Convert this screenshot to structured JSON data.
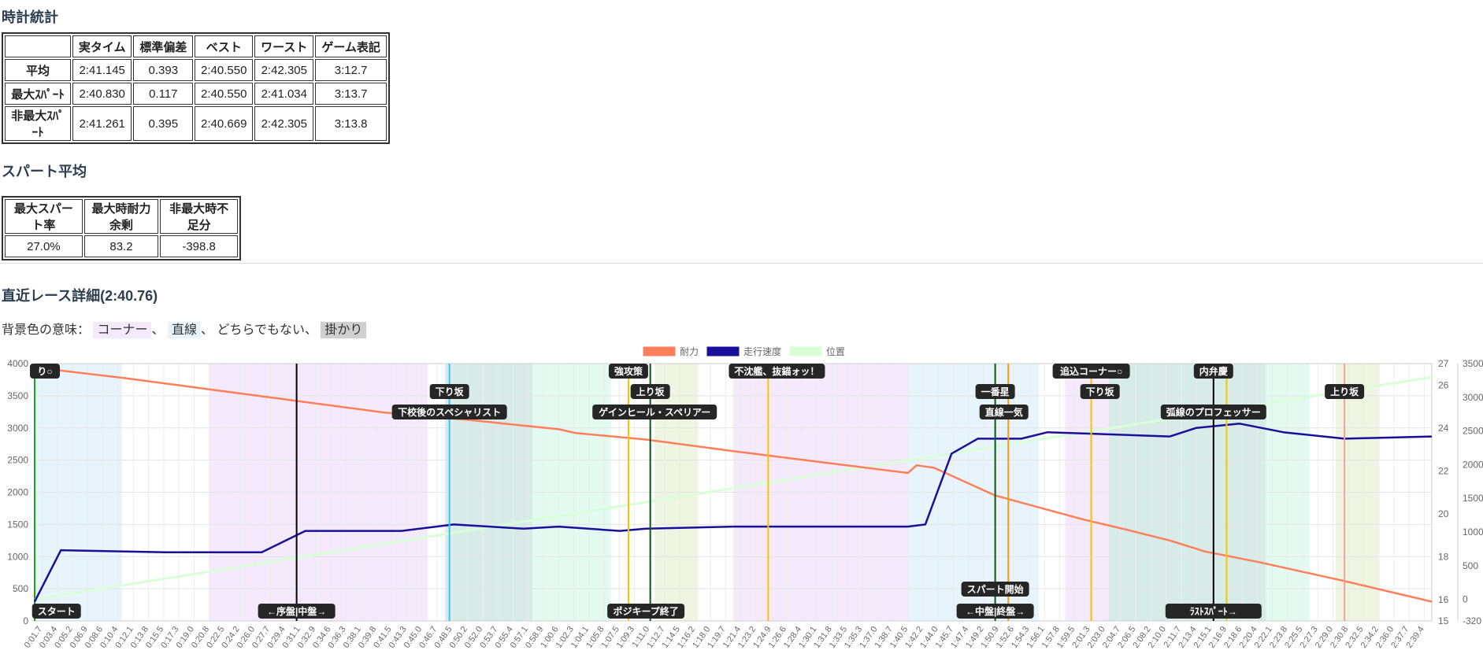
{
  "clock_stats": {
    "title": "時計統計",
    "headers": [
      "",
      "実タイム",
      "標準偏差",
      "ベスト",
      "ワースト",
      "ゲーム表記"
    ],
    "rows": [
      [
        "平均",
        "2:41.145",
        "0.393",
        "2:40.550",
        "2:42.305",
        "3:12.7"
      ],
      [
        "最大ｽﾊﾟｰﾄ",
        "2:40.830",
        "0.117",
        "2:40.550",
        "2:41.034",
        "3:13.7"
      ],
      [
        "非最大ｽﾊﾟｰﾄ",
        "2:41.261",
        "0.395",
        "2:40.669",
        "2:42.305",
        "3:13.8"
      ]
    ]
  },
  "spurt_avg": {
    "title": "スパート平均",
    "headers": [
      "最大スパート率",
      "最大時耐力余剰",
      "非最大時不足分"
    ],
    "values": [
      "27.0%",
      "83.2",
      "-398.8"
    ]
  },
  "recent_race": {
    "title": "直近レース詳細(2:40.76)",
    "bg_legend": {
      "prefix": "背景色の意味：",
      "corner": "コーナー",
      "sep1": "、",
      "straight": "直線",
      "sep2": "、",
      "neither": "どちらでもない、",
      "kakari": "掛かり"
    }
  },
  "colors": {
    "stamina": "#ff7f5a",
    "speed": "#1a0f9a",
    "position": "#d9ffd9",
    "corner_bg": "#f4eafc",
    "straight_bg": "#e8f4fb",
    "kakari_bg": "#d0d0d0"
  },
  "chart_data": {
    "type": "line",
    "legend": [
      "耐力",
      "走行速度",
      "位置"
    ],
    "y_left": {
      "min": 0,
      "max": 4000,
      "ticks": [
        "4000",
        "3500",
        "3000",
        "2500",
        "2000",
        "1500",
        "1000",
        "500",
        "0"
      ]
    },
    "y_right_speed": {
      "min": 15,
      "max": 27,
      "ticks": [
        "27",
        "26",
        "24",
        "22",
        "20",
        "18",
        "16",
        "15"
      ]
    },
    "y_right_position": {
      "min": -320,
      "max": 3500,
      "ticks": [
        "3500",
        "3000",
        "2500",
        "2000",
        "1500",
        "1000",
        "500",
        "0",
        "-320"
      ]
    },
    "x_ticks": [
      "0:01.7",
      "0:03.4",
      "0:05.2",
      "0:06.9",
      "0:08.6",
      "0:10.4",
      "0:12.1",
      "0:13.8",
      "0:15.5",
      "0:17.3",
      "0:19.0",
      "0:20.8",
      "0:22.5",
      "0:24.2",
      "0:26.0",
      "0:27.7",
      "0:29.4",
      "0:31.1",
      "0:32.9",
      "0:34.6",
      "0:36.3",
      "0:38.1",
      "0:39.8",
      "0:41.5",
      "0:43.3",
      "0:45.0",
      "0:46.7",
      "0:48.5",
      "0:50.2",
      "0:52.0",
      "0:53.7",
      "0:55.4",
      "0:57.1",
      "0:58.9",
      "1:00.6",
      "1:02.3",
      "1:04.1",
      "1:05.8",
      "1:07.5",
      "1:09.3",
      "1:11.0",
      "1:12.7",
      "1:14.5",
      "1:16.2",
      "1:18.0",
      "1:19.7",
      "1:21.4",
      "1:23.2",
      "1:24.9",
      "1:26.6",
      "1:28.4",
      "1:30.1",
      "1:31.8",
      "1:33.5",
      "1:35.3",
      "1:37.0",
      "1:38.7",
      "1:40.5",
      "1:42.2",
      "1:44.0",
      "1:45.7",
      "1:47.4",
      "1:49.2",
      "1:50.9",
      "1:52.6",
      "1:54.3",
      "1:56.1",
      "1:57.8",
      "1:59.5",
      "2:01.3",
      "2:03.0",
      "2:04.7",
      "2:06.5",
      "2:08.2",
      "2:10.0",
      "2:11.7",
      "2:13.4",
      "2:15.1",
      "2:16.9",
      "2:18.6",
      "2:20.4",
      "2:22.1",
      "2:23.8",
      "2:25.5",
      "2:27.3",
      "2:29.0",
      "2:30.8",
      "2:32.5",
      "2:34.2",
      "2:36.0",
      "2:37.7",
      "2:39.4"
    ],
    "stamina": [
      [
        0,
        3940
      ],
      [
        10,
        3780
      ],
      [
        20,
        3600
      ],
      [
        30,
        3420
      ],
      [
        40,
        3240
      ],
      [
        50,
        3120
      ],
      [
        60,
        2980
      ],
      [
        62,
        2920
      ],
      [
        70,
        2820
      ],
      [
        80,
        2640
      ],
      [
        90,
        2470
      ],
      [
        100,
        2300
      ],
      [
        101,
        2420
      ],
      [
        103,
        2380
      ],
      [
        110,
        1950
      ],
      [
        120,
        1580
      ],
      [
        125,
        1420
      ],
      [
        130,
        1250
      ],
      [
        134,
        1080
      ],
      [
        140,
        920
      ],
      [
        150,
        620
      ],
      [
        160,
        300
      ]
    ],
    "speed": [
      [
        0,
        15.9
      ],
      [
        3,
        18.3
      ],
      [
        15,
        18.2
      ],
      [
        20,
        18.2
      ],
      [
        26,
        18.2
      ],
      [
        31,
        19.2
      ],
      [
        42,
        19.2
      ],
      [
        48,
        19.5
      ],
      [
        56,
        19.3
      ],
      [
        60,
        19.4
      ],
      [
        67,
        19.2
      ],
      [
        70,
        19.3
      ],
      [
        80,
        19.4
      ],
      [
        100,
        19.4
      ],
      [
        102,
        19.5
      ],
      [
        105,
        22.8
      ],
      [
        108,
        23.5
      ],
      [
        113,
        23.5
      ],
      [
        116,
        23.8
      ],
      [
        130,
        23.6
      ],
      [
        133,
        24.0
      ],
      [
        138,
        24.2
      ],
      [
        143,
        23.8
      ],
      [
        150,
        23.5
      ],
      [
        160,
        23.6
      ]
    ],
    "position": [
      [
        0,
        0
      ],
      [
        160,
        3300
      ]
    ],
    "events": [
      {
        "label": "スタート",
        "pos": "bottom",
        "x": 2.5
      },
      {
        "label": "←序盤|中盤→",
        "pos": "bottom",
        "x": 30
      },
      {
        "label": "下り坂",
        "pos": "top2",
        "x": 47.5
      },
      {
        "label": "下校後のスペシャリスト",
        "pos": "top3",
        "x": 47.5
      },
      {
        "label": "強攻策",
        "pos": "top1",
        "x": 68
      },
      {
        "label": "上り坂",
        "pos": "top2",
        "x": 70.5
      },
      {
        "label": "ゲインヒール・スペリアー",
        "pos": "top3",
        "x": 71
      },
      {
        "label": "ポジキープ終了",
        "pos": "bottom",
        "x": 70
      },
      {
        "label": "不沈艦、抜錨ォッ！",
        "pos": "top1",
        "x": 85
      },
      {
        "label": "一番星",
        "pos": "top2",
        "x": 110
      },
      {
        "label": "直線一気",
        "pos": "top3",
        "x": 111
      },
      {
        "label": "スパート開始",
        "pos": "bottom2",
        "x": 110
      },
      {
        "label": "←中盤|終盤→",
        "pos": "bottom",
        "x": 110
      },
      {
        "label": "追込コーナー○",
        "pos": "top1",
        "x": 121
      },
      {
        "label": "下り坂",
        "pos": "top2",
        "x": 122
      },
      {
        "label": "弧線のプロフェッサー",
        "pos": "top3",
        "x": 135
      },
      {
        "label": "内弁慶",
        "pos": "top1",
        "x": 135
      },
      {
        "label": "ﾗｽﾄｽﾊﾟｰﾄ→",
        "pos": "bottom",
        "x": 135
      },
      {
        "label": "上り坂",
        "pos": "top2",
        "x": 150
      },
      {
        "label": "り○",
        "pos": "top1",
        "x": 1
      }
    ]
  }
}
